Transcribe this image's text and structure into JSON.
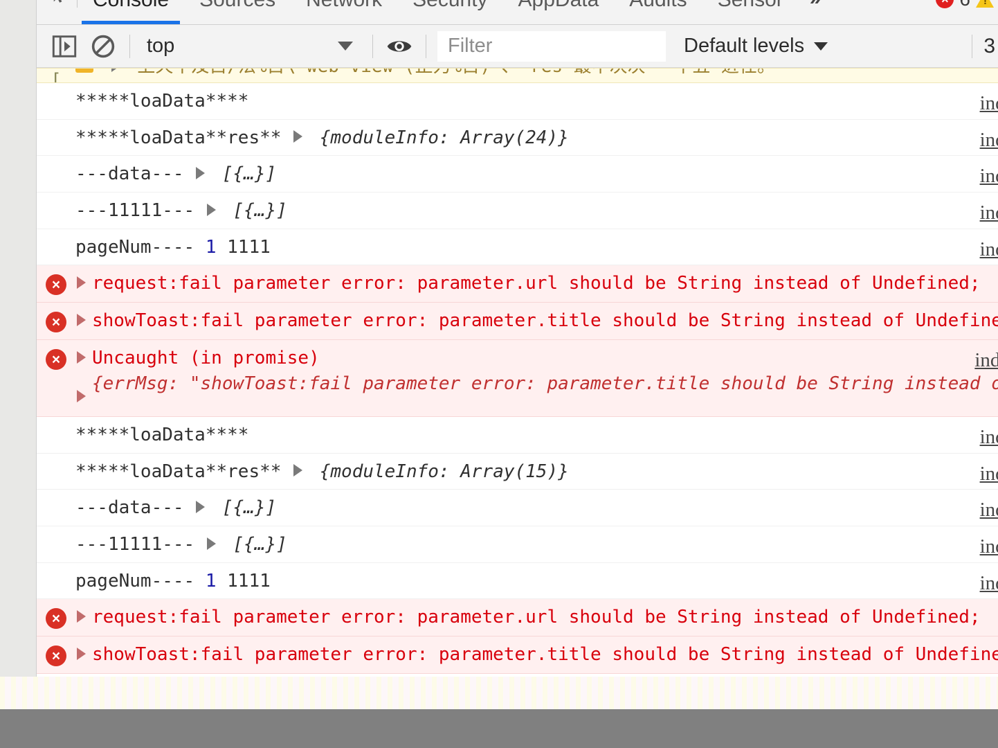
{
  "panel": {
    "inspect_icon": "inspect-element-icon",
    "tabs": [
      {
        "label": "Console",
        "active": true
      },
      {
        "label": "Sources",
        "active": false
      },
      {
        "label": "Network",
        "active": false
      },
      {
        "label": "Security",
        "active": false
      },
      {
        "label": "AppData",
        "active": false
      },
      {
        "label": "Audits",
        "active": false
      },
      {
        "label": "Sensor",
        "active": false
      }
    ],
    "overflow_label": "»",
    "error_count": "6",
    "warning_icon": "warning-triangle-icon"
  },
  "toolbar": {
    "sidebar_toggle_icon": "show-console-sidebar-icon",
    "clear_icon": "clear-console-icon",
    "context_value": "top",
    "eye_icon": "live-expression-icon",
    "filter_placeholder": "Filter",
    "filter_value": "",
    "levels_label": "Default levels",
    "truncated_right": "3"
  },
  "console": {
    "rows": [
      {
        "type": "warning-clipped",
        "text": "上天不及目/法%目\\ web view (正力%目) 、 res 最中次次 一千五 进任。",
        "source": ""
      },
      {
        "type": "log",
        "text": "*****loaData****",
        "source": "index"
      },
      {
        "type": "log-object",
        "text": "*****loaData**res**",
        "object": "{moduleInfo: Array(24)}",
        "source": "index"
      },
      {
        "type": "log-object",
        "text": "---data---",
        "object": "[{…}]",
        "source": "index"
      },
      {
        "type": "log-object",
        "text": "---11111---",
        "object": "[{…}]",
        "source": "index"
      },
      {
        "type": "log-number",
        "text": "pageNum----",
        "number": "1",
        "tail": "1111",
        "source": "index"
      },
      {
        "type": "error",
        "text": "request:fail parameter error: parameter.url should be String instead of Undefined;",
        "source": ""
      },
      {
        "type": "error",
        "text": "showToast:fail parameter error: parameter.title should be String instead of Undefined;",
        "source": ""
      },
      {
        "type": "error-expanded",
        "text": "Uncaught (in promise)",
        "detail": "{errMsg: \"showToast:fail parameter error: parameter.title should be String instead of Undefined;\"}",
        "source": "index."
      },
      {
        "type": "log",
        "text": "*****loaData****",
        "source": "index"
      },
      {
        "type": "log-object",
        "text": "*****loaData**res**",
        "object": "{moduleInfo: Array(15)}",
        "source": "index"
      },
      {
        "type": "log-object",
        "text": "---data---",
        "object": "[{…}]",
        "source": "index"
      },
      {
        "type": "log-object",
        "text": "---11111---",
        "object": "[{…}]",
        "source": "index"
      },
      {
        "type": "log-number",
        "text": "pageNum----",
        "number": "1",
        "tail": "1111",
        "source": "index"
      },
      {
        "type": "error",
        "text": "request:fail parameter error: parameter.url should be String instead of Undefined;",
        "source": ""
      },
      {
        "type": "error",
        "text": "showToast:fail parameter error: parameter.title should be String instead of Undefined;",
        "source": ""
      }
    ]
  },
  "colors": {
    "accent": "#1a73e8",
    "error_text": "#d8000c",
    "error_bg": "#fff0f0",
    "warning_bg": "#fffbe5",
    "panel_bg": "#ffffff",
    "toolbar_bg": "#f3f3f3",
    "outer_bg": "#e8e8e6",
    "footer_gray": "#808080"
  }
}
